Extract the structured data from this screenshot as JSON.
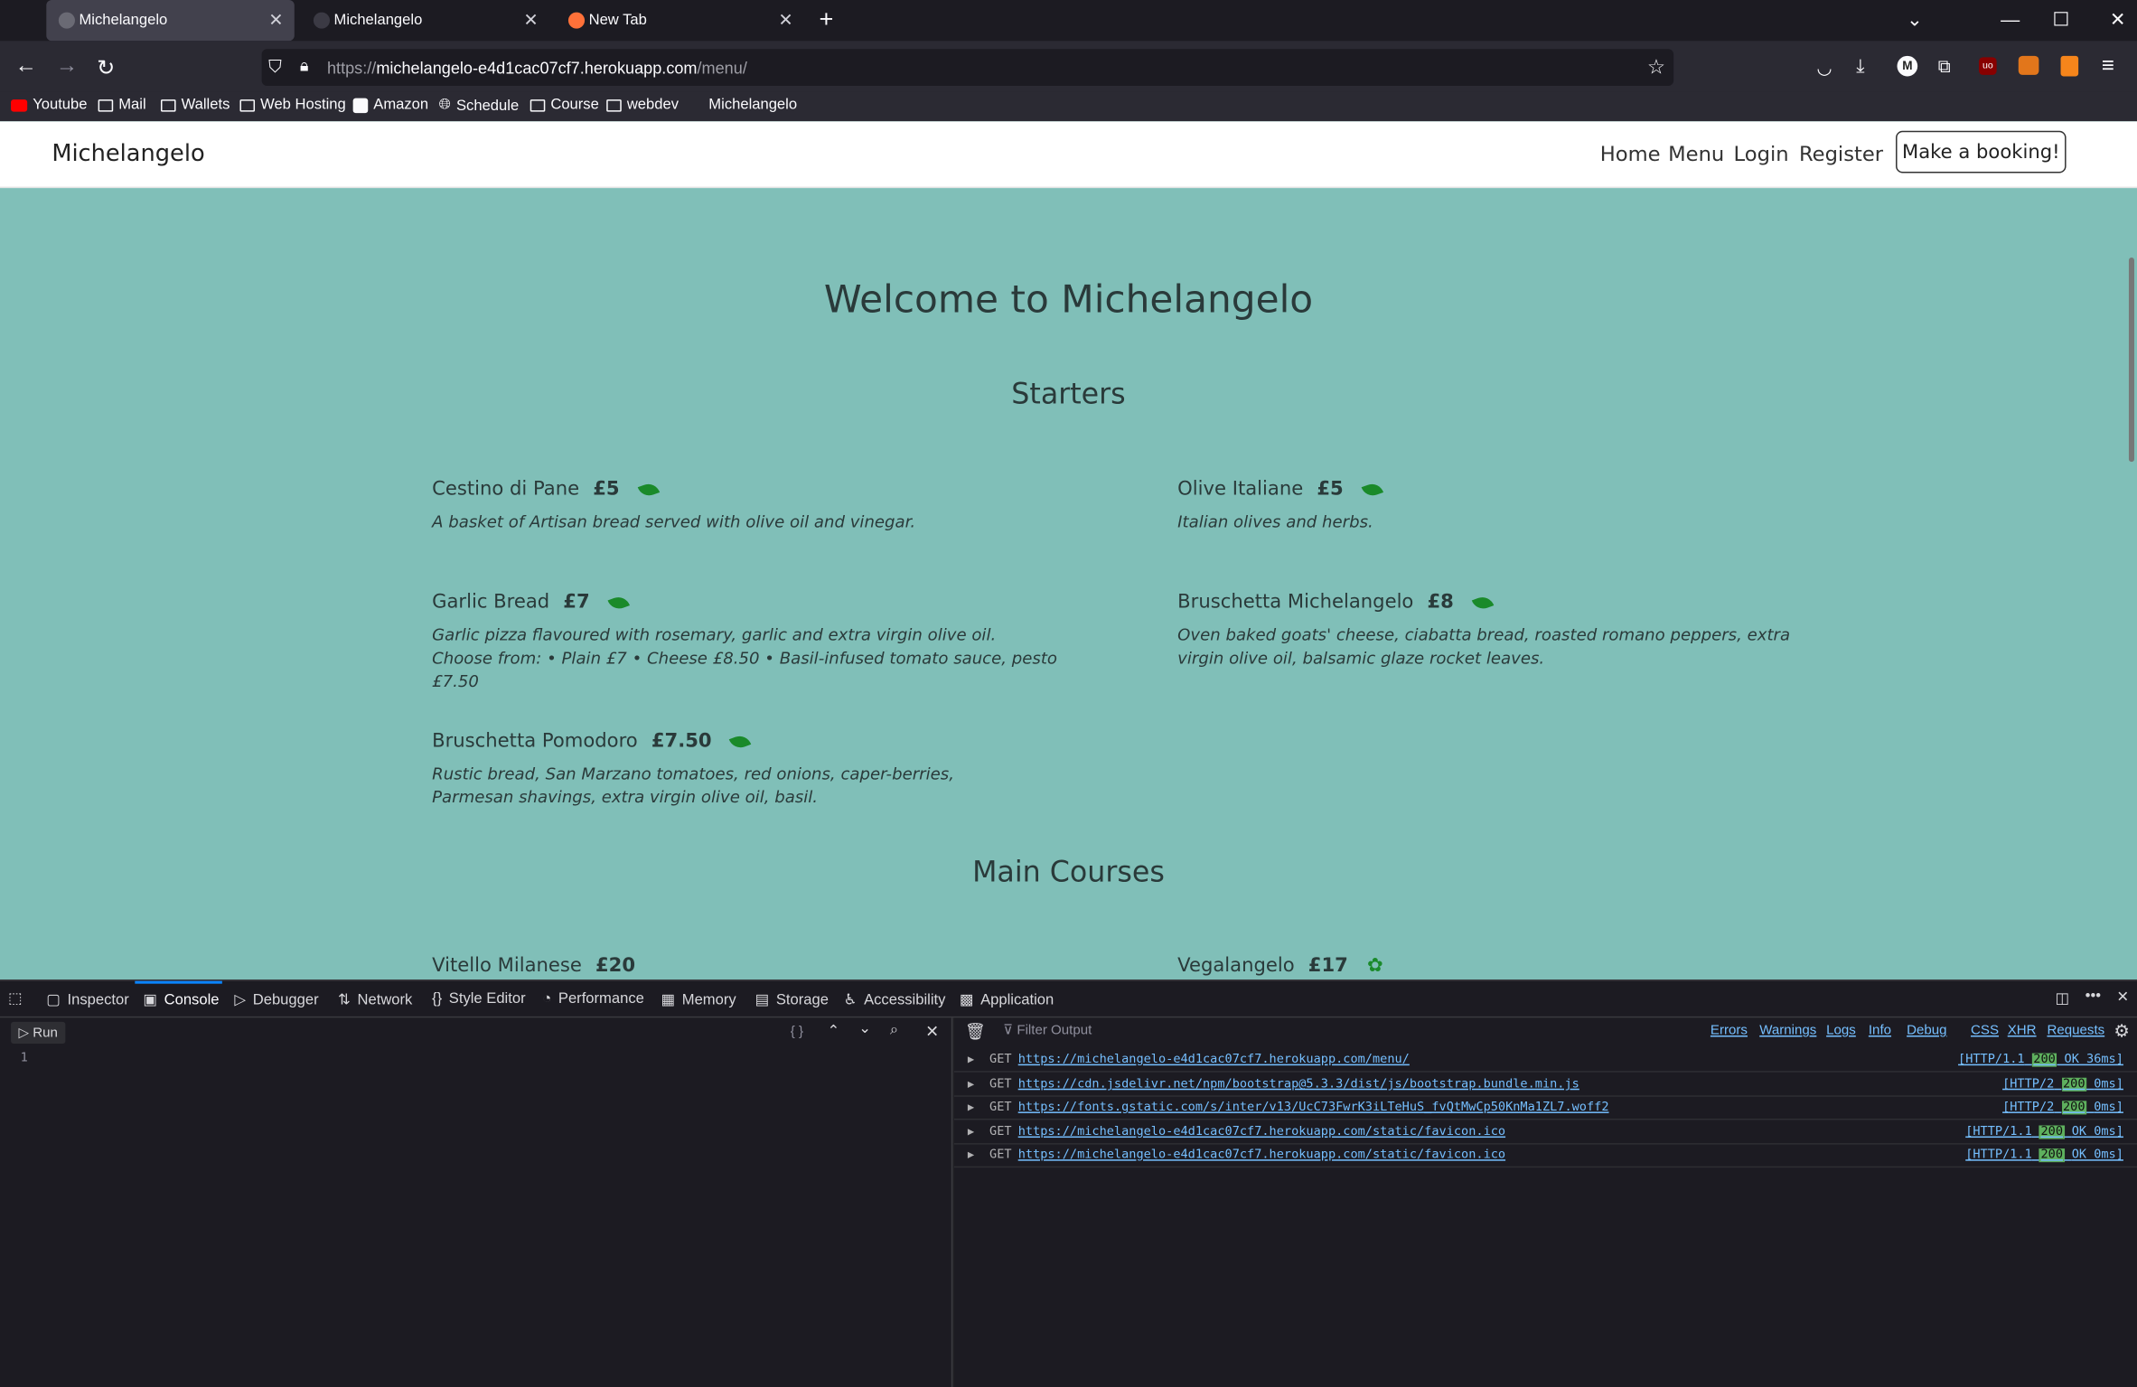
{
  "browser": {
    "tabs": [
      {
        "title": "Michelangelo",
        "active": true
      },
      {
        "title": "Michelangelo",
        "active": false
      },
      {
        "title": "New Tab",
        "active": false
      }
    ],
    "url_prefix": "https://",
    "url_host": "michelangelo-e4d1cac07cf7.herokuapp.com",
    "url_path": "/menu/",
    "bookmarks": [
      "Youtube",
      "Mail",
      "Wallets",
      "Web Hosting",
      "Amazon",
      "Schedule",
      "Course",
      "webdev",
      "Michelangelo"
    ]
  },
  "site": {
    "brand": "Michelangelo",
    "nav": [
      "Home",
      "Menu",
      "Login",
      "Register"
    ],
    "booking_button": "Make a booking!",
    "heading": "Welcome to Michelangelo",
    "starters_title": "Starters",
    "starters": [
      {
        "name": "Cestino di Pane",
        "price": "£5",
        "desc": "A basket of Artisan bread served with olive oil and vinegar."
      },
      {
        "name": "Olive Italiane",
        "price": "£5",
        "desc": "Italian olives and herbs."
      },
      {
        "name": "Garlic Bread",
        "price": "£7",
        "desc": "Garlic pizza flavoured with rosemary, garlic and extra virgin olive oil. Choose from: • Plain £7 • Cheese £8.50 • Basil-infused tomato sauce, pesto £7.50"
      },
      {
        "name": "Bruschetta Michelangelo",
        "price": "£8",
        "desc": "Oven baked goats' cheese, ciabatta bread, roasted romano peppers, extra virgin olive oil, balsamic glaze rocket leaves."
      },
      {
        "name": "Bruschetta Pomodoro",
        "price": "£7.50",
        "desc": "Rustic bread, San Marzano tomatoes, red onions, caper-berries, Parmesan shavings, extra virgin olive oil, basil."
      }
    ],
    "mains_title": "Main Courses",
    "mains": [
      {
        "name": "Vitello Milanese",
        "price": "£20"
      },
      {
        "name": "Vegalangelo",
        "price": "£17"
      }
    ]
  },
  "devtools": {
    "tabs": [
      "Inspector",
      "Console",
      "Debugger",
      "Network",
      "Style Editor",
      "Performance",
      "Memory",
      "Storage",
      "Accessibility",
      "Application"
    ],
    "run_label": "Run",
    "line_number": "1",
    "editor_braces": "{ }",
    "filter_placeholder": "Filter Output",
    "filters": [
      "Errors",
      "Warnings",
      "Logs",
      "Info",
      "Debug",
      "CSS",
      "XHR",
      "Requests"
    ],
    "logs": [
      {
        "method": "GET",
        "url": "https://michelangelo-e4d1cac07cf7.herokuapp.com/menu/",
        "proto": "[HTTP/1.1",
        "code": "200",
        "status": "OK 36ms]"
      },
      {
        "method": "GET",
        "url": "https://cdn.jsdelivr.net/npm/bootstrap@5.3.3/dist/js/bootstrap.bundle.min.js",
        "proto": "[HTTP/2",
        "code": "200",
        "status": "0ms]"
      },
      {
        "method": "GET",
        "url": "https://fonts.gstatic.com/s/inter/v13/UcC73FwrK3iLTeHuS_fvQtMwCp50KnMa1ZL7.woff2",
        "proto": "[HTTP/2",
        "code": "200",
        "status": "0ms]"
      },
      {
        "method": "GET",
        "url": "https://michelangelo-e4d1cac07cf7.herokuapp.com/static/favicon.ico",
        "proto": "[HTTP/1.1",
        "code": "200",
        "status": "OK 0ms]"
      },
      {
        "method": "GET",
        "url": "https://michelangelo-e4d1cac07cf7.herokuapp.com/static/favicon.ico",
        "proto": "[HTTP/1.1",
        "code": "200",
        "status": "OK 0ms]"
      }
    ]
  }
}
